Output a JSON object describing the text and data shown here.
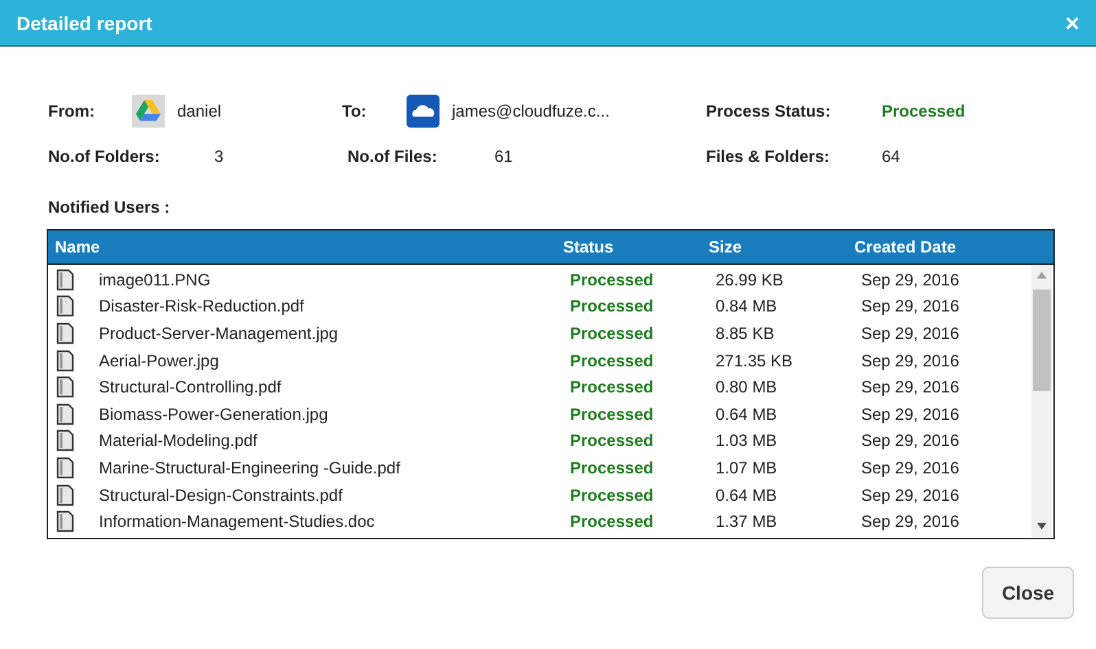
{
  "window": {
    "title": "Detailed report",
    "close": "×"
  },
  "from": {
    "label": "From:",
    "value": "daniel"
  },
  "to": {
    "label": "To:",
    "value": "james@cloudfuze.c..."
  },
  "process_status": {
    "label": "Process Status:",
    "value": "Processed"
  },
  "folders": {
    "label": "No.of Folders:",
    "value": "3"
  },
  "files": {
    "label": "No.of Files:",
    "value": "61"
  },
  "files_and_folders": {
    "label": "Files & Folders:",
    "value": "64"
  },
  "notified_users": {
    "label": "Notified Users :"
  },
  "table": {
    "columns": [
      "Name",
      "Status",
      "Size",
      "Created Date"
    ],
    "rows": [
      {
        "name": "image011.PNG",
        "status": "Processed",
        "size": "26.99 KB",
        "created": "Sep 29, 2016"
      },
      {
        "name": "Disaster-Risk-Reduction.pdf",
        "status": "Processed",
        "size": "0.84 MB",
        "created": "Sep 29, 2016"
      },
      {
        "name": "Product-Server-Management.jpg",
        "status": "Processed",
        "size": "8.85 KB",
        "created": "Sep 29, 2016"
      },
      {
        "name": "Aerial-Power.jpg",
        "status": "Processed",
        "size": "271.35 KB",
        "created": "Sep 29, 2016"
      },
      {
        "name": "Structural-Controlling.pdf",
        "status": "Processed",
        "size": "0.80 MB",
        "created": "Sep 29, 2016"
      },
      {
        "name": "Biomass-Power-Generation.jpg",
        "status": "Processed",
        "size": "0.64 MB",
        "created": "Sep 29, 2016"
      },
      {
        "name": "Material-Modeling.pdf",
        "status": "Processed",
        "size": "1.03 MB",
        "created": "Sep 29, 2016"
      },
      {
        "name": "Marine-Structural-Engineering -Guide.pdf",
        "status": "Processed",
        "size": "1.07 MB",
        "created": "Sep 29, 2016"
      },
      {
        "name": "Structural-Design-Constraints.pdf",
        "status": "Processed",
        "size": "0.64 MB",
        "created": "Sep 29, 2016"
      },
      {
        "name": "Information-Management-Studies.doc",
        "status": "Processed",
        "size": "1.37 MB",
        "created": "Sep 29, 2016"
      }
    ]
  },
  "buttons": [
    "Close"
  ]
}
